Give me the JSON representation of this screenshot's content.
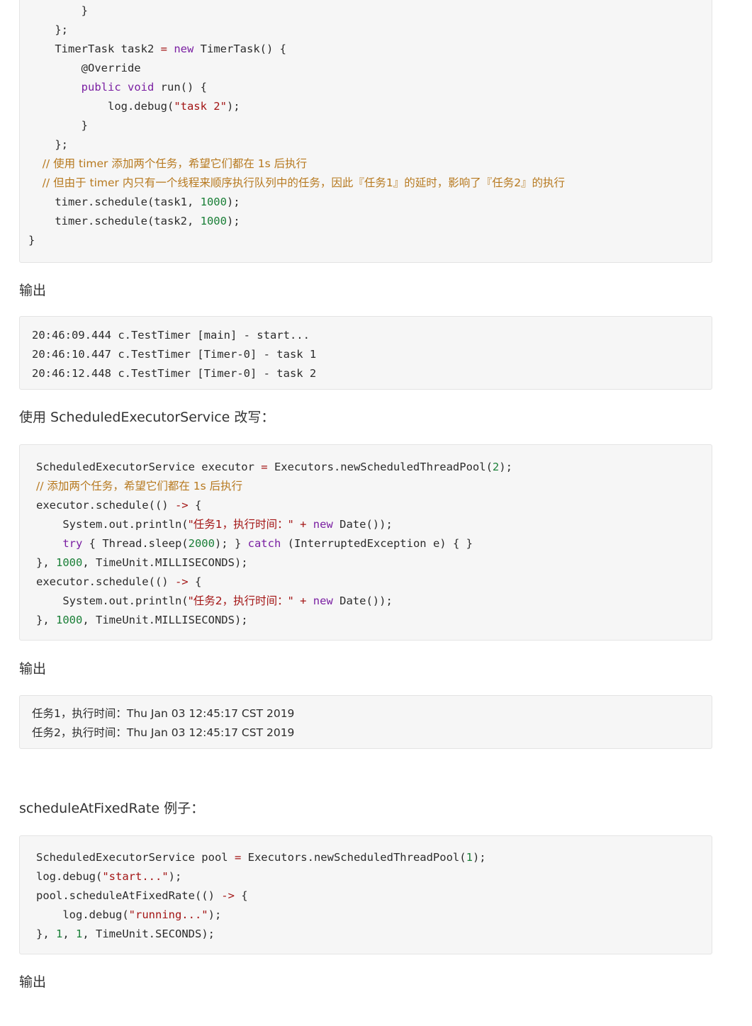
{
  "block1": {
    "lines": [
      [
        {
          "t": "        }",
          "c": ""
        }
      ],
      [
        {
          "t": "    };",
          "c": ""
        }
      ],
      [
        {
          "t": "    TimerTask task2 ",
          "c": ""
        },
        {
          "t": "=",
          "c": "op"
        },
        {
          "t": " ",
          "c": ""
        },
        {
          "t": "new",
          "c": "kw"
        },
        {
          "t": " TimerTask() {",
          "c": ""
        }
      ],
      [
        {
          "t": "        @Override",
          "c": ""
        }
      ],
      [
        {
          "t": "        ",
          "c": ""
        },
        {
          "t": "public",
          "c": "kw"
        },
        {
          "t": " ",
          "c": ""
        },
        {
          "t": "void",
          "c": "kw"
        },
        {
          "t": " run() {",
          "c": ""
        }
      ],
      [
        {
          "t": "            log.debug(",
          "c": ""
        },
        {
          "t": "\"task 2\"",
          "c": "str"
        },
        {
          "t": ");",
          "c": ""
        }
      ],
      [
        {
          "t": "        }",
          "c": ""
        }
      ],
      [
        {
          "t": "    };",
          "c": ""
        }
      ],
      [
        {
          "t": "    // 使用 timer 添加两个任务，希望它们都在 1s 后执行",
          "c": "cm"
        }
      ],
      [
        {
          "t": "    // 但由于 timer 内只有一个线程来顺序执行队列中的任务，因此『任务1』的延时，影响了『任务2』的执行",
          "c": "cm"
        }
      ],
      [
        {
          "t": "    timer.schedule(task1, ",
          "c": ""
        },
        {
          "t": "1000",
          "c": "num"
        },
        {
          "t": ");",
          "c": ""
        }
      ],
      [
        {
          "t": "    timer.schedule(task2, ",
          "c": ""
        },
        {
          "t": "1000",
          "c": "num"
        },
        {
          "t": ");",
          "c": ""
        }
      ],
      [
        {
          "t": "}",
          "c": ""
        }
      ]
    ]
  },
  "label1": "输出",
  "block2": {
    "lines": [
      [
        {
          "t": "20:46:09.444 c.TestTimer [main] - start...",
          "c": ""
        }
      ],
      [
        {
          "t": "20:46:10.447 c.TestTimer [Timer-0] - task 1",
          "c": ""
        }
      ],
      [
        {
          "t": "20:46:12.448 c.TestTimer [Timer-0] - task 2",
          "c": ""
        }
      ]
    ]
  },
  "label2": "使用 ScheduledExecutorService 改写：",
  "block3": {
    "lines": [
      [
        {
          "t": "ScheduledExecutorService executor ",
          "c": ""
        },
        {
          "t": "=",
          "c": "op"
        },
        {
          "t": " Executors.newScheduledThreadPool(",
          "c": ""
        },
        {
          "t": "2",
          "c": "num"
        },
        {
          "t": ");",
          "c": ""
        }
      ],
      [
        {
          "t": "// 添加两个任务，希望它们都在 1s 后执行",
          "c": "cm"
        }
      ],
      [
        {
          "t": "executor.schedule(() ",
          "c": ""
        },
        {
          "t": "->",
          "c": "op"
        },
        {
          "t": " {",
          "c": ""
        }
      ],
      [
        {
          "t": "    System.out.println(",
          "c": ""
        },
        {
          "t": "\"任务1，执行时间：\"",
          "c": "str"
        },
        {
          "t": " ",
          "c": ""
        },
        {
          "t": "+",
          "c": "op"
        },
        {
          "t": " ",
          "c": ""
        },
        {
          "t": "new",
          "c": "kw"
        },
        {
          "t": " Date());",
          "c": ""
        }
      ],
      [
        {
          "t": "    ",
          "c": ""
        },
        {
          "t": "try",
          "c": "kw"
        },
        {
          "t": " { Thread.sleep(",
          "c": ""
        },
        {
          "t": "2000",
          "c": "num"
        },
        {
          "t": "); } ",
          "c": ""
        },
        {
          "t": "catch",
          "c": "kw"
        },
        {
          "t": " (InterruptedException e) { }",
          "c": ""
        }
      ],
      [
        {
          "t": "}, ",
          "c": ""
        },
        {
          "t": "1000",
          "c": "num"
        },
        {
          "t": ", TimeUnit.MILLISECONDS);",
          "c": ""
        }
      ],
      [
        {
          "t": "executor.schedule(() ",
          "c": ""
        },
        {
          "t": "->",
          "c": "op"
        },
        {
          "t": " {",
          "c": ""
        }
      ],
      [
        {
          "t": "    System.out.println(",
          "c": ""
        },
        {
          "t": "\"任务2，执行时间：\"",
          "c": "str"
        },
        {
          "t": " ",
          "c": ""
        },
        {
          "t": "+",
          "c": "op"
        },
        {
          "t": " ",
          "c": ""
        },
        {
          "t": "new",
          "c": "kw"
        },
        {
          "t": " Date());",
          "c": ""
        }
      ],
      [
        {
          "t": "}, ",
          "c": ""
        },
        {
          "t": "1000",
          "c": "num"
        },
        {
          "t": ", TimeUnit.MILLISECONDS);",
          "c": ""
        }
      ]
    ]
  },
  "label3": "输出",
  "block4": {
    "lines": [
      [
        {
          "t": "任务1，执行时间：Thu Jan 03 12:45:17 CST 2019",
          "c": ""
        }
      ],
      [
        {
          "t": "任务2，执行时间：Thu Jan 03 12:45:17 CST 2019",
          "c": ""
        }
      ]
    ]
  },
  "label4": "scheduleAtFixedRate 例子：",
  "block5": {
    "lines": [
      [
        {
          "t": "ScheduledExecutorService pool ",
          "c": ""
        },
        {
          "t": "=",
          "c": "op"
        },
        {
          "t": " Executors.newScheduledThreadPool(",
          "c": ""
        },
        {
          "t": "1",
          "c": "num"
        },
        {
          "t": ");",
          "c": ""
        }
      ],
      [
        {
          "t": "log.debug(",
          "c": ""
        },
        {
          "t": "\"start...\"",
          "c": "str"
        },
        {
          "t": ");",
          "c": ""
        }
      ],
      [
        {
          "t": "pool.scheduleAtFixedRate(() ",
          "c": ""
        },
        {
          "t": "->",
          "c": "op"
        },
        {
          "t": " {",
          "c": ""
        }
      ],
      [
        {
          "t": "    log.debug(",
          "c": ""
        },
        {
          "t": "\"running...\"",
          "c": "str"
        },
        {
          "t": ");",
          "c": ""
        }
      ],
      [
        {
          "t": "}, ",
          "c": ""
        },
        {
          "t": "1",
          "c": "num"
        },
        {
          "t": ", ",
          "c": ""
        },
        {
          "t": "1",
          "c": "num"
        },
        {
          "t": ", TimeUnit.SECONDS);",
          "c": ""
        }
      ]
    ]
  },
  "label5": "输出",
  "colors": {
    "keyword": "#7a1fa2",
    "string": "#a31515",
    "number": "#1a7f37",
    "comment": "#b7791f",
    "code_bg": "#f6f6f6"
  }
}
